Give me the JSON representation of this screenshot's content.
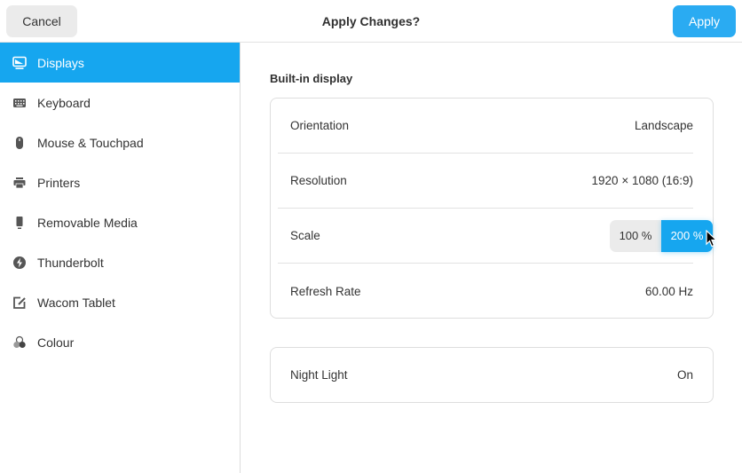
{
  "header": {
    "title": "Apply Changes?",
    "cancel_label": "Cancel",
    "apply_label": "Apply"
  },
  "colors": {
    "accent": "#16a6ef",
    "apply_button": "#2aabf2"
  },
  "sidebar": {
    "items": [
      {
        "label": "Displays",
        "icon": "display-icon",
        "active": true
      },
      {
        "label": "Keyboard",
        "icon": "keyboard-icon",
        "active": false
      },
      {
        "label": "Mouse & Touchpad",
        "icon": "mouse-icon",
        "active": false
      },
      {
        "label": "Printers",
        "icon": "printer-icon",
        "active": false
      },
      {
        "label": "Removable Media",
        "icon": "removable-media-icon",
        "active": false
      },
      {
        "label": "Thunderbolt",
        "icon": "thunderbolt-icon",
        "active": false
      },
      {
        "label": "Wacom Tablet",
        "icon": "tablet-icon",
        "active": false
      },
      {
        "label": "Colour",
        "icon": "colour-icon",
        "active": false
      }
    ]
  },
  "main": {
    "section_title": "Built-in display",
    "display_settings": [
      {
        "label": "Orientation",
        "value": "Landscape"
      },
      {
        "label": "Resolution",
        "value": "1920 × 1080 (16:9)"
      },
      {
        "label": "Scale",
        "options": [
          "100 %",
          "200 %"
        ],
        "selected": "200 %"
      },
      {
        "label": "Refresh Rate",
        "value": "60.00 Hz"
      }
    ],
    "night_light": {
      "label": "Night Light",
      "value": "On"
    }
  }
}
